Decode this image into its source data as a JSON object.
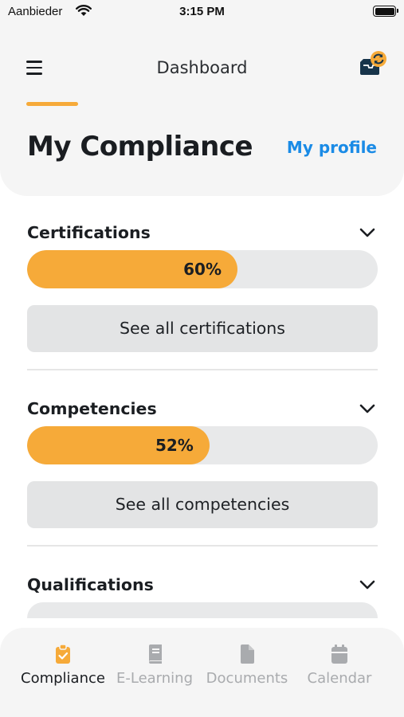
{
  "status_bar": {
    "carrier": "Aanbieder",
    "time": "3:15 PM"
  },
  "topbar": {
    "title": "Dashboard"
  },
  "page": {
    "title": "My Compliance",
    "profile_link": "My profile"
  },
  "sections": [
    {
      "title": "Certifications",
      "progress": 0.6,
      "progress_label": "60%",
      "button_label": "See all certifications"
    },
    {
      "title": "Competencies",
      "progress": 0.52,
      "progress_label": "52%",
      "button_label": "See all competencies"
    },
    {
      "title": "Qualifications"
    }
  ],
  "tabs": [
    {
      "label": "Compliance",
      "icon": "clipboard-check-icon",
      "active": true
    },
    {
      "label": "E-Learning",
      "icon": "book-icon",
      "active": false
    },
    {
      "label": "Documents",
      "icon": "document-icon",
      "active": false
    },
    {
      "label": "Calendar",
      "icon": "calendar-icon",
      "active": false
    }
  ],
  "colors": {
    "accent": "#f6aa39",
    "link": "#1a8be6",
    "inactive_tab": "#a9abae"
  }
}
